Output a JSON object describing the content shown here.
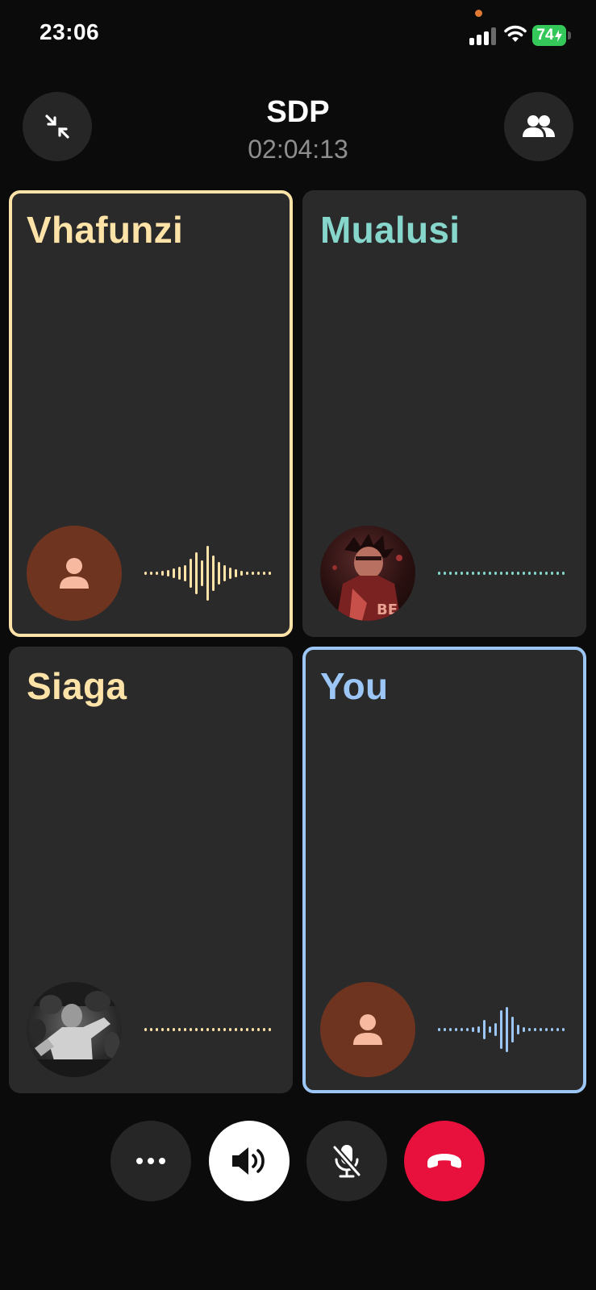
{
  "status_bar": {
    "time": "23:06",
    "battery": "74",
    "icons": [
      "signal-icon",
      "wifi-icon",
      "battery-charging-icon"
    ]
  },
  "header": {
    "title": "SDP",
    "timer": "02:04:13",
    "left_button_icon": "minimize-arrows-icon",
    "right_button_icon": "participants-icon"
  },
  "participants": [
    {
      "name": "Vhafunzi",
      "color": "#fde3a7",
      "avatar": "default-person-icon",
      "speaking": true,
      "highlighted": true
    },
    {
      "name": "Mualusi",
      "color": "#86d6cc",
      "avatar": "photo",
      "speaking": false,
      "highlighted": false
    },
    {
      "name": "Siaga",
      "color": "#fde3a7",
      "avatar": "photo",
      "speaking": false,
      "highlighted": false
    },
    {
      "name": "You",
      "color": "#9cc6f5",
      "avatar": "default-person-icon",
      "speaking": true,
      "highlighted": true
    }
  ],
  "controls": [
    {
      "icon": "more-icon",
      "background": "#262626"
    },
    {
      "icon": "speaker-icon",
      "background": "#ffffff"
    },
    {
      "icon": "mic-muted-icon",
      "background": "#262626"
    },
    {
      "icon": "end-call-icon",
      "background": "#e8103c"
    }
  ]
}
